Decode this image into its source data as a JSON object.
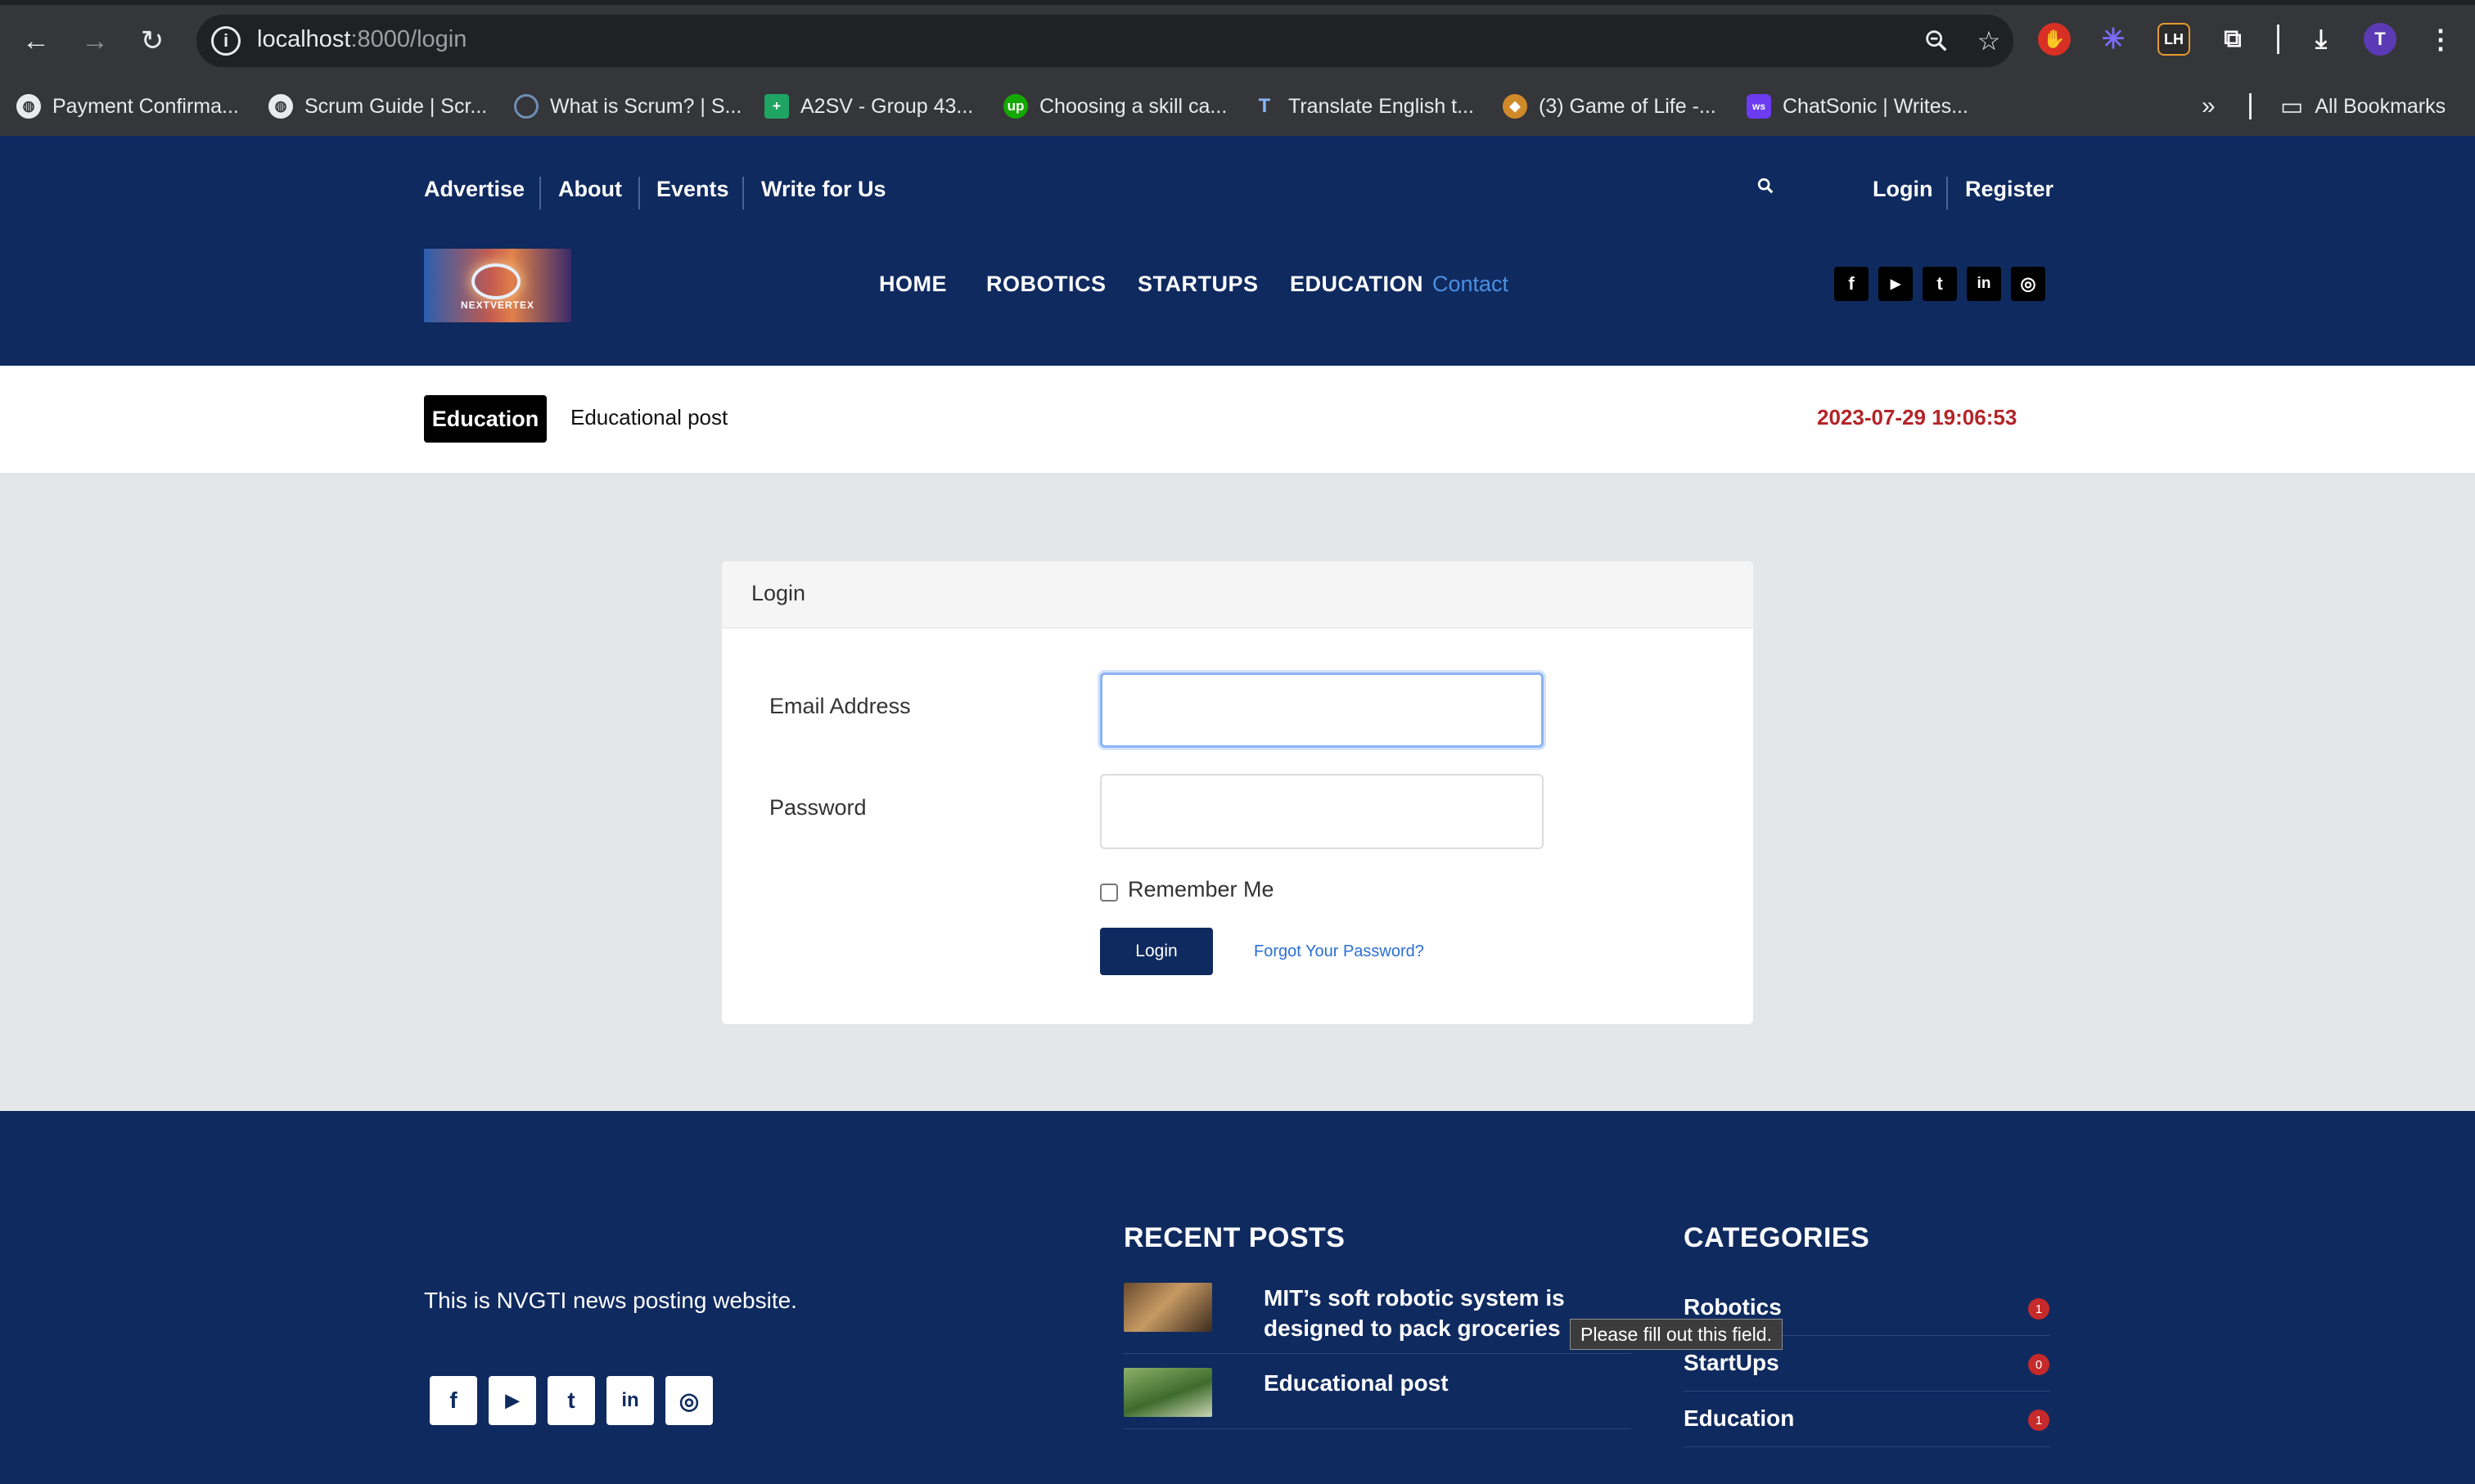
{
  "browser": {
    "url_host": "localhost",
    "url_path": ":8000/login",
    "bookmarks": [
      {
        "label": "Payment Confirma...",
        "icon": "globe-icon"
      },
      {
        "label": "Scrum Guide | Scr...",
        "icon": "globe-icon"
      },
      {
        "label": "What is Scrum? | S...",
        "icon": "scrum-org-icon"
      },
      {
        "label": "A2SV - Group 43...",
        "icon": "sheets-icon"
      },
      {
        "label": "Choosing a skill ca...",
        "icon": "upwork-icon"
      },
      {
        "label": "Translate English t...",
        "icon": "translate-icon"
      },
      {
        "label": "(3) Game of Life -...",
        "icon": "game-icon"
      },
      {
        "label": "ChatSonic | Writes...",
        "icon": "chatsonic-icon"
      }
    ],
    "all_bookmarks": "All Bookmarks",
    "profile_initial": "T"
  },
  "header": {
    "top_links": [
      "Advertise",
      "About",
      "Events",
      "Write for Us"
    ],
    "login": "Login",
    "register": "Register",
    "logo_text": "NEXTVERTEX",
    "nav": [
      "HOME",
      "ROBOTICS",
      "STARTUPS",
      "EDUCATION",
      "Contact"
    ],
    "social": [
      "f",
      "▶",
      "t",
      "in",
      "◎"
    ]
  },
  "ticker": {
    "badge": "Education",
    "text": "Educational post",
    "datetime": "2023-07-29 19:06:53"
  },
  "login_form": {
    "title": "Login",
    "email_label": "Email Address",
    "email_value": "",
    "password_label": "Password",
    "password_value": "",
    "remember_label": "Remember Me",
    "submit": "Login",
    "forgot": "Forgot Your Password?"
  },
  "footer": {
    "about": "This is NVGTI news posting website.",
    "social": [
      "f",
      "▶",
      "t",
      "in",
      "◎"
    ],
    "recent_heading": "RECENT POSTS",
    "posts": [
      {
        "title": "MIT’s soft robotic system is designed to pack groceries"
      },
      {
        "title": "Educational post"
      }
    ],
    "categories_heading": "CATEGORIES",
    "categories": [
      {
        "name": "Robotics",
        "count": "1"
      },
      {
        "name": "StartUps",
        "count": "0"
      },
      {
        "name": "Education",
        "count": "1"
      }
    ]
  },
  "tooltip": "Please fill out this field.",
  "colors": {
    "brand_navy": "#0f2a5f",
    "contact_link": "#4a90e2",
    "date_red": "#b32428",
    "badge_red": "#c62a2a"
  }
}
